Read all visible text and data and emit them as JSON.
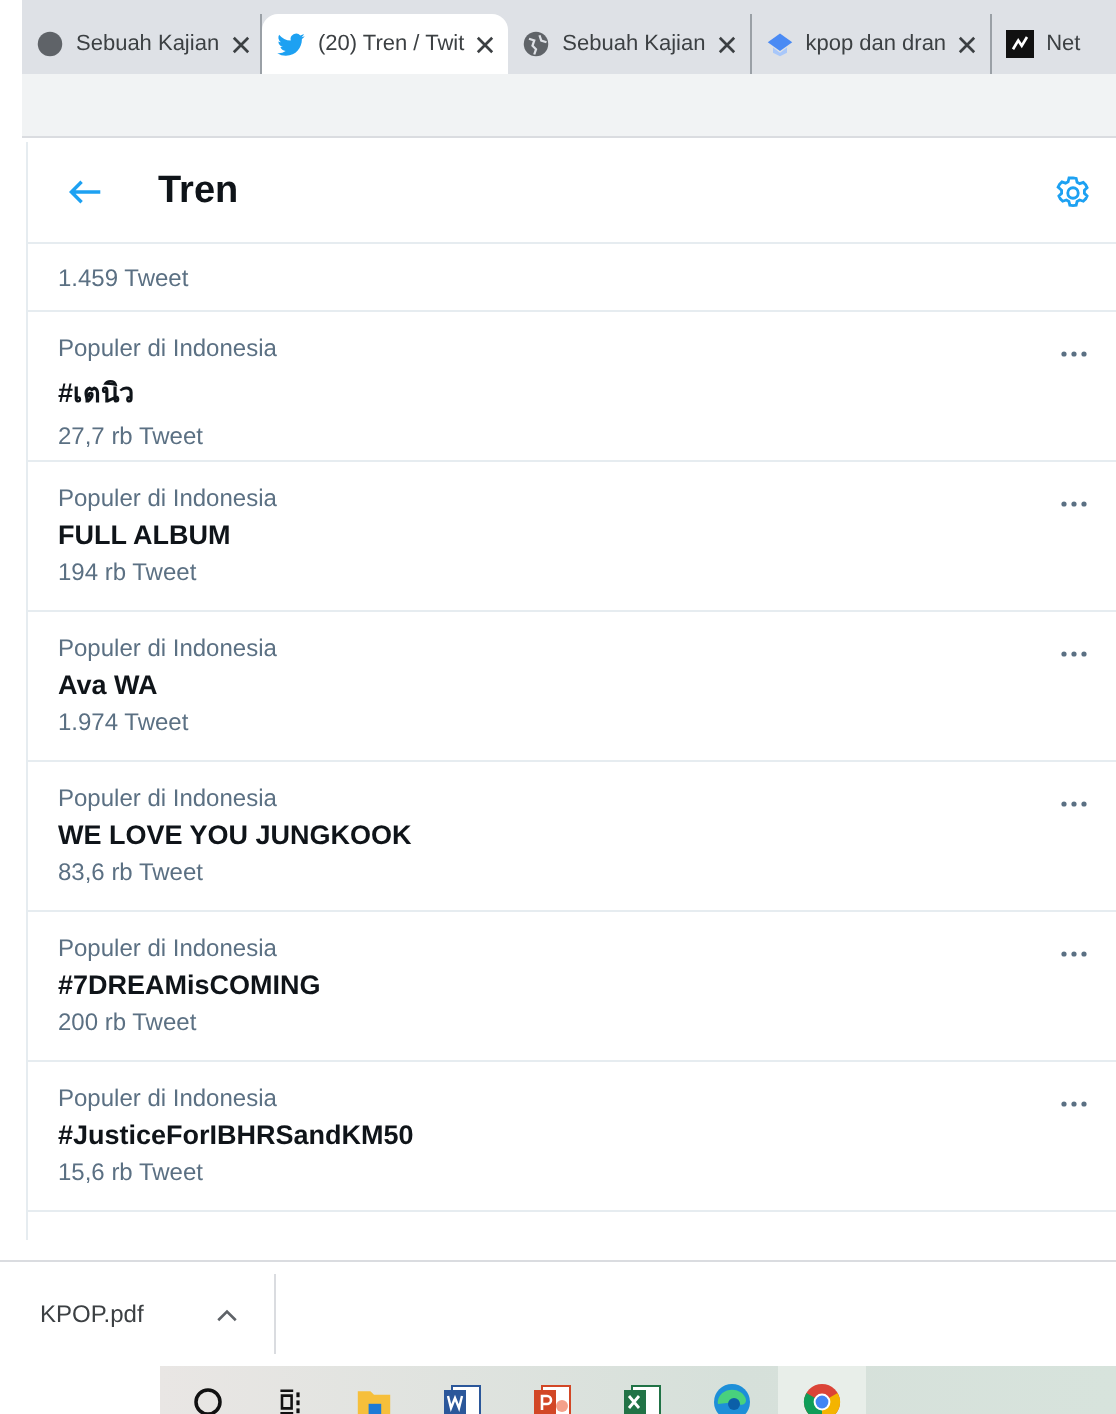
{
  "tabs": [
    {
      "title": "Sebuah Kajian",
      "selected": false
    },
    {
      "title": "(20) Tren / Twit",
      "selected": true
    },
    {
      "title": "Sebuah Kajian",
      "selected": false
    },
    {
      "title": "kpop dan dran",
      "selected": false
    },
    {
      "title": "Net",
      "selected": false
    }
  ],
  "header": {
    "title": "Tren"
  },
  "partial_row": {
    "count": "1.459 Tweet"
  },
  "trends": [
    {
      "context": "Populer di Indonesia",
      "name": "#เตนิว",
      "count": "27,7 rb Tweet"
    },
    {
      "context": "Populer di Indonesia",
      "name": "FULL ALBUM",
      "count": "194 rb Tweet"
    },
    {
      "context": "Populer di Indonesia",
      "name": "Ava WA",
      "count": "1.974 Tweet"
    },
    {
      "context": "Populer di Indonesia",
      "name": "WE LOVE YOU JUNGKOOK",
      "count": "83,6 rb Tweet"
    },
    {
      "context": "Populer di Indonesia",
      "name": "#7DREAMisCOMING",
      "count": "200 rb Tweet"
    },
    {
      "context": "Populer di Indonesia",
      "name": "#JusticeForIBHRSandKM50",
      "count": "15,6 rb Tweet"
    }
  ],
  "download": {
    "file": "KPOP.pdf"
  }
}
